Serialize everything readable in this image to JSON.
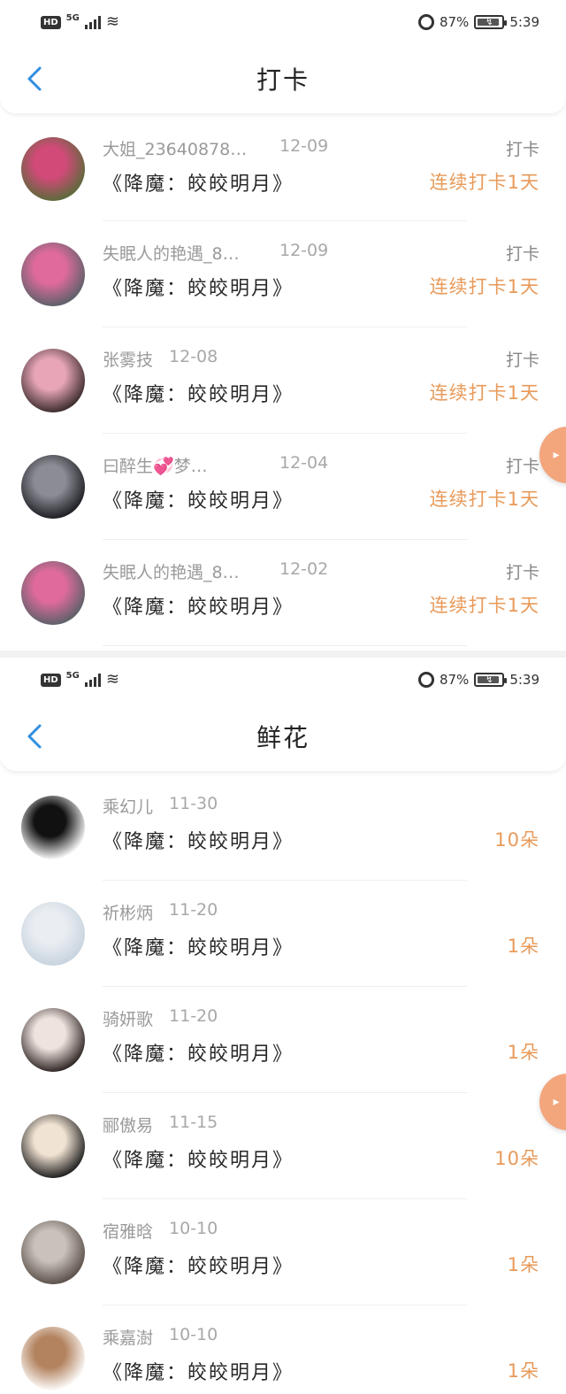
{
  "status_bar": {
    "network": "5G",
    "hd": "HD",
    "battery_percent": "87%",
    "time": "5:39"
  },
  "checkin_page": {
    "title": "打卡",
    "entries": [
      {
        "name": "大姐_23640878…",
        "date": "12-09",
        "book": "《降魔：皎皎明月》",
        "tag": "打卡",
        "value": "连续打卡1天",
        "avatar_colors": [
          "#5a6b3a",
          "#d14a78"
        ]
      },
      {
        "name": "失眠人的艳遇_8…",
        "date": "12-09",
        "book": "《降魔：皎皎明月》",
        "tag": "打卡",
        "value": "连续打卡1天",
        "avatar_colors": [
          "#5b6168",
          "#e06b9b"
        ]
      },
      {
        "name": "张雾技",
        "date": "12-08",
        "book": "《降魔：皎皎明月》",
        "tag": "打卡",
        "value": "连续打卡1天",
        "avatar_colors": [
          "#3a2b2b",
          "#e7a5b7"
        ]
      },
      {
        "name": "曰醉生💞梦…",
        "date": "12-04",
        "book": "《降魔：皎皎明月》",
        "tag": "打卡",
        "value": "连续打卡1天",
        "avatar_colors": [
          "#1c1c22",
          "#8c8c95"
        ]
      },
      {
        "name": "失眠人的艳遇_8…",
        "date": "12-02",
        "book": "《降魔：皎皎明月》",
        "tag": "打卡",
        "value": "连续打卡1天",
        "avatar_colors": [
          "#5b6168",
          "#e06b9b"
        ]
      }
    ]
  },
  "flower_page": {
    "title": "鲜花",
    "entries": [
      {
        "name": "乘幻儿",
        "date": "11-30",
        "book": "《降魔：皎皎明月》",
        "value": "10朵",
        "avatar_colors": [
          "#ffffff",
          "#111111"
        ]
      },
      {
        "name": "祈彬炳",
        "date": "11-20",
        "book": "《降魔：皎皎明月》",
        "value": "1朵",
        "avatar_colors": [
          "#c7d3de",
          "#eaeef2"
        ]
      },
      {
        "name": "骑妍歌",
        "date": "11-20",
        "book": "《降魔：皎皎明月》",
        "value": "1朵",
        "avatar_colors": [
          "#2c2322",
          "#efe3de"
        ]
      },
      {
        "name": "郦傲易",
        "date": "11-15",
        "book": "《降魔：皎皎明月》",
        "value": "10朵",
        "avatar_colors": [
          "#1d1d1d",
          "#f1e3d3"
        ]
      },
      {
        "name": "宿雅晗",
        "date": "10-10",
        "book": "《降魔：皎皎明月》",
        "value": "1朵",
        "avatar_colors": [
          "#5a4e48",
          "#c9c2bb"
        ]
      },
      {
        "name": "乘嘉澍",
        "date": "10-10",
        "book": "《降魔：皎皎明月》",
        "value": "1朵",
        "avatar_colors": [
          "#ffffff",
          "#b3835f"
        ]
      }
    ]
  },
  "colors": {
    "accent_orange": "#e89a5a",
    "back_arrow": "#2f8fe0",
    "float_badge": "#f3a57c"
  },
  "icons": [
    "back-arrow-icon",
    "wifi-icon",
    "signal-icon",
    "alarm-icon",
    "battery-icon"
  ]
}
